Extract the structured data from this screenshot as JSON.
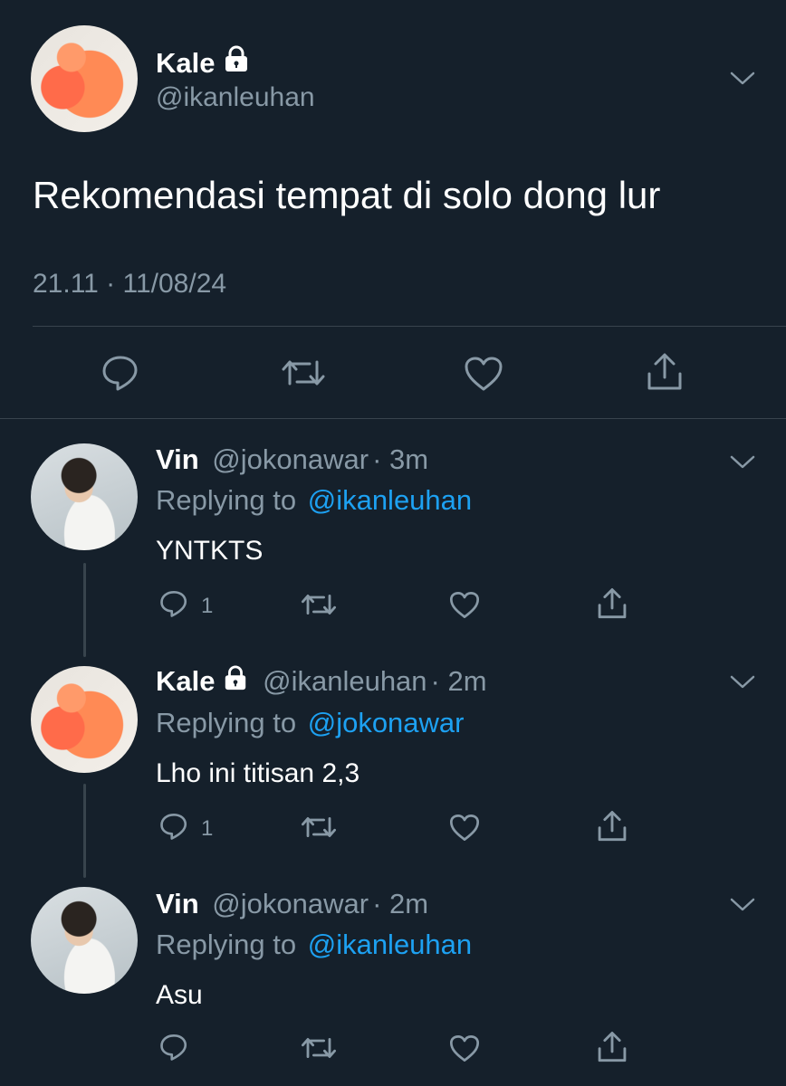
{
  "main_tweet": {
    "name": "Kale",
    "handle": "@ikanleuhan",
    "text": "Rekomendasi tempat di solo dong lur",
    "timestamp": "21.11 · 11/08/24"
  },
  "replies": [
    {
      "name": "Vin",
      "handle": "@jokonawar",
      "time": "· 3m",
      "replying_prefix": "Replying to",
      "replying_to": "@ikanleuhan",
      "text": "YNTKTS",
      "reply_count": "1"
    },
    {
      "name": "Kale",
      "handle": "@ikanleuhan",
      "time": "· 2m",
      "replying_prefix": "Replying to",
      "replying_to": "@jokonawar",
      "text": "Lho ini titisan 2,3",
      "reply_count": "1"
    },
    {
      "name": "Vin",
      "handle": "@jokonawar",
      "time": "· 2m",
      "replying_prefix": "Replying to",
      "replying_to": "@ikanleuhan",
      "text": "Asu",
      "reply_count": ""
    }
  ],
  "colors": {
    "background": "#15202b",
    "muted": "#8899a6",
    "link": "#1da1f2",
    "divider": "#38444d"
  },
  "icons": [
    "lock-icon",
    "chevron-down-icon",
    "reply-icon",
    "retweet-icon",
    "like-icon",
    "share-icon"
  ]
}
